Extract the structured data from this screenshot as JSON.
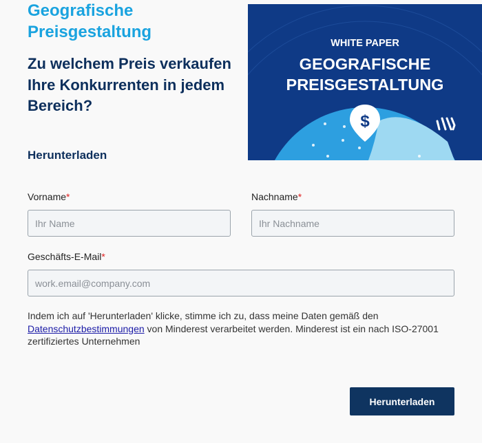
{
  "header": {
    "title": "Geografische Preisgestaltung",
    "subtitle": "Zu welchem Preis verkaufen Ihre Konkurrenten in jedem Bereich?",
    "section_label": "Herunterladen"
  },
  "banner": {
    "kicker": "WHITE PAPER",
    "title_line1": "GEOGRAFISCHE",
    "title_line2": "PREISGESTALTUNG",
    "pin_symbol": "$",
    "logo_icon": "minderest-logo-icon",
    "bg_color": "#0f3a86",
    "globe_color": "#5cc8f2"
  },
  "form": {
    "first_name": {
      "label": "Vorname",
      "required_mark": "*",
      "placeholder": "Ihr Name",
      "value": ""
    },
    "last_name": {
      "label": "Nachname",
      "required_mark": "*",
      "placeholder": "Ihr Nachname",
      "value": ""
    },
    "email": {
      "label": "Geschäfts-E-Mail",
      "required_mark": "*",
      "placeholder": "work.email@company.com",
      "value": ""
    },
    "consent": {
      "text_before": "Indem ich auf 'Herunterladen' klicke, stimme ich zu, dass meine Daten gemäß den ",
      "link_text": "Datenschutzbestimmungen",
      "text_after": " von Minderest verarbeitet werden. Minderest ist ein nach ISO-27001 zertifiziertes Unternehmen"
    },
    "submit_label": "Herunterladen"
  },
  "colors": {
    "accent": "#1aa3df",
    "heading": "#0d2f5c",
    "button": "#0f3460",
    "required": "#e02020"
  }
}
